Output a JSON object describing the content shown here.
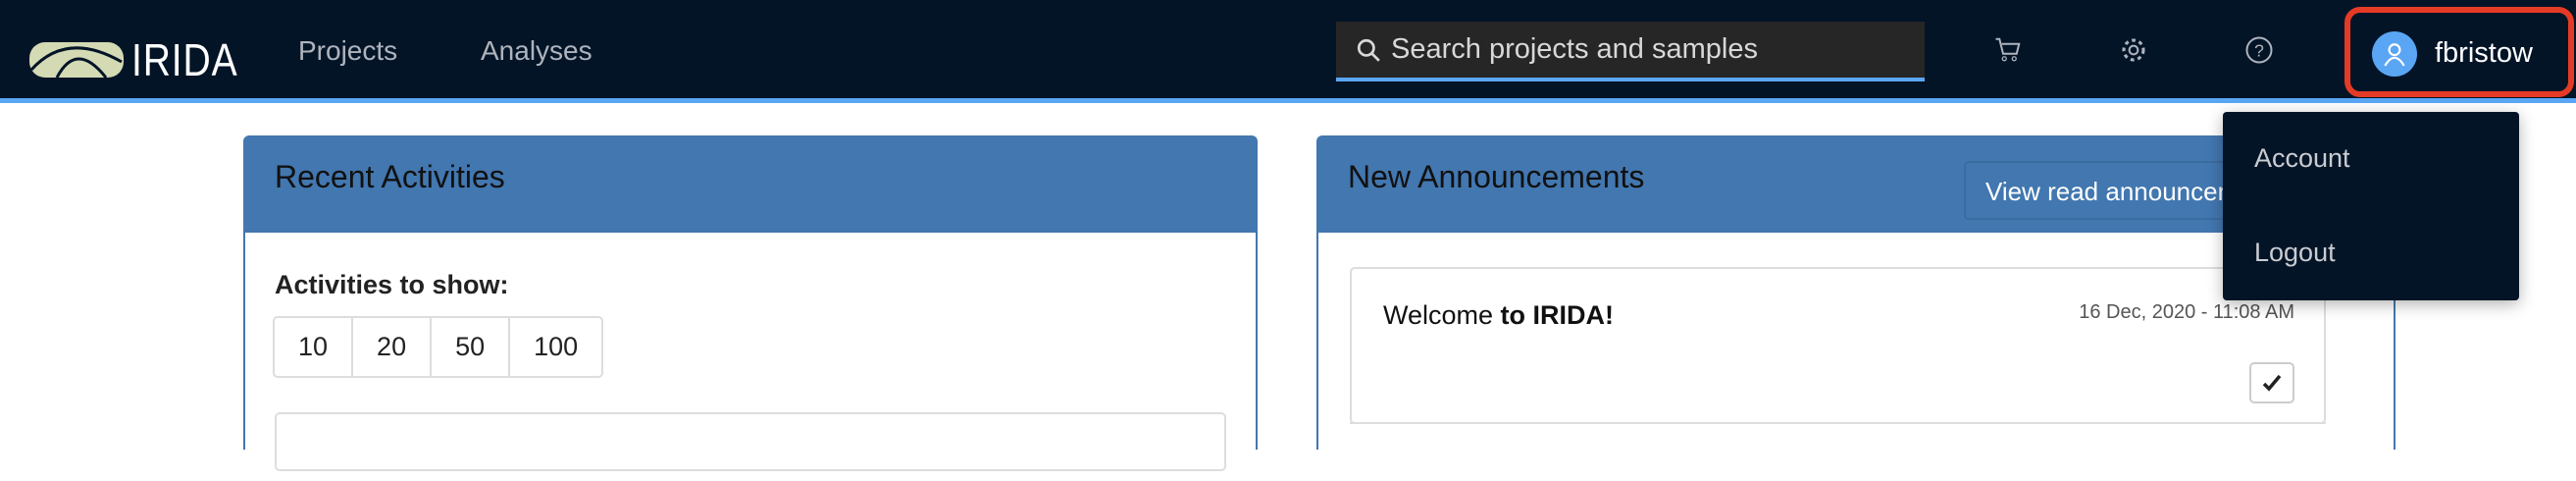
{
  "nav": {
    "brand": "IRIDA",
    "links": [
      "Projects",
      "Analyses"
    ],
    "search_placeholder": "Search projects and samples",
    "username": "fbristow",
    "icons": [
      "cart-icon",
      "gear-icon",
      "help-icon",
      "user-icon"
    ]
  },
  "user_menu": [
    "Account",
    "Logout"
  ],
  "recent": {
    "title": "Recent Activities",
    "show_label": "Activities to show:",
    "options": [
      "10",
      "20",
      "50",
      "100"
    ]
  },
  "announcements": {
    "title": "New Announcements",
    "view_read": "View read announcements",
    "items": [
      {
        "text_plain": "Welcome ",
        "text_bold": "to IRIDA!",
        "date": "16 Dec, 2020 - 11:08 AM"
      }
    ]
  },
  "colors": {
    "nav": "#041427",
    "accent": "#5aa6f5",
    "panel": "#4277b0",
    "highlight": "#e53b26"
  }
}
